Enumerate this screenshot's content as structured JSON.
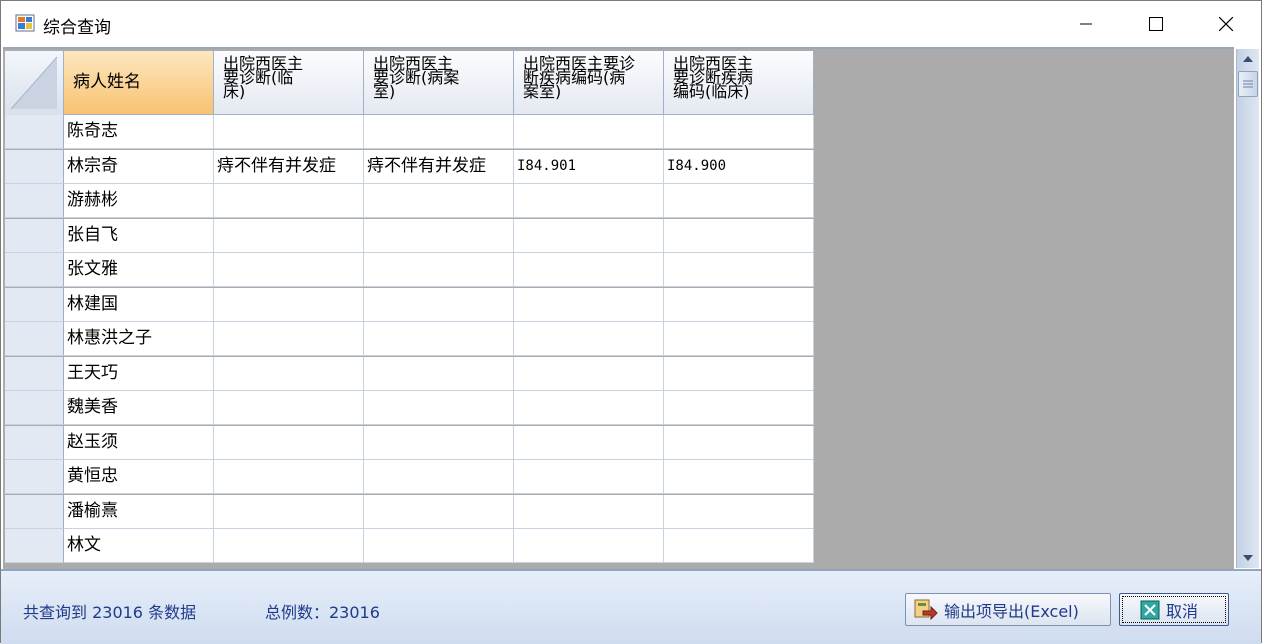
{
  "window": {
    "title": "综合查询"
  },
  "columns": [
    {
      "label": "病人姓名"
    },
    {
      "label": "出院西医主\n要诊断(临\n床)"
    },
    {
      "label": "出院西医主\n要诊断(病案\n室)"
    },
    {
      "label": "出院西医主要诊\n断疾病编码(病\n案室)"
    },
    {
      "label": "出院西医主\n要诊断疾病\n编码(临床)"
    }
  ],
  "rows": [
    [
      "陈奇志",
      "",
      "",
      "",
      ""
    ],
    [
      "林宗奇",
      "痔不伴有并发症",
      "痔不伴有并发症",
      "I84.901",
      "I84.900"
    ],
    [
      "游赫彬",
      "",
      "",
      "",
      ""
    ],
    [
      "张自飞",
      "",
      "",
      "",
      ""
    ],
    [
      "张文雅",
      "",
      "",
      "",
      ""
    ],
    [
      "林建国",
      "",
      "",
      "",
      ""
    ],
    [
      "林惠洪之子",
      "",
      "",
      "",
      ""
    ],
    [
      "王天巧",
      "",
      "",
      "",
      ""
    ],
    [
      "魏美香",
      "",
      "",
      "",
      ""
    ],
    [
      "赵玉须",
      "",
      "",
      "",
      ""
    ],
    [
      "黄恒忠",
      "",
      "",
      "",
      ""
    ],
    [
      "潘榆熹",
      "",
      "",
      "",
      ""
    ],
    [
      "林文",
      "",
      "",
      "",
      ""
    ]
  ],
  "footer": {
    "query_count": "共查询到 23016 条数据",
    "total_cases": "总例数：23016",
    "export_label": "输出项导出(Excel)",
    "cancel_label": "取消"
  },
  "icons": {
    "app": "app-window-icon",
    "minimize": "minimize-icon",
    "maximize": "maximize-icon",
    "close": "close-icon",
    "export": "excel-export-icon",
    "cancel": "cancel-x-icon"
  },
  "colors": {
    "active_header": "#f8c272",
    "grid_background": "#ababab",
    "footer_text": "#1f3a8a"
  }
}
